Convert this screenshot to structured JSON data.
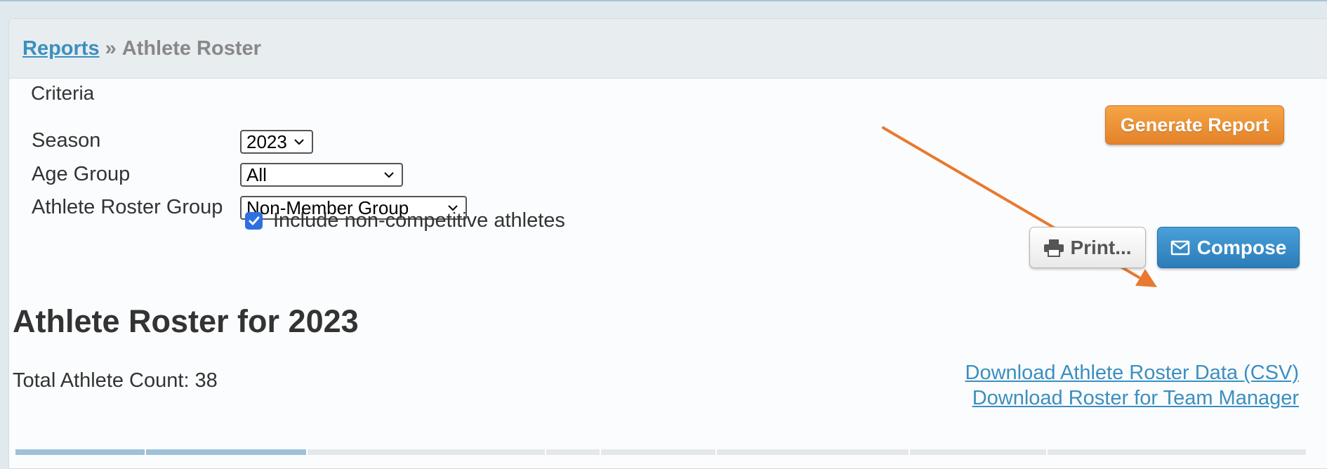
{
  "breadcrumb": {
    "root": "Reports",
    "separator": "»",
    "current": "Athlete Roster"
  },
  "criteria": {
    "heading": "Criteria",
    "season": {
      "label": "Season",
      "value": "2023"
    },
    "age_group": {
      "label": "Age Group",
      "value": "All"
    },
    "roster_group": {
      "label": "Athlete Roster Group",
      "value": "Non-Member Group"
    },
    "include_noncompetitive": {
      "label": "Include non-competitive athletes",
      "checked": true
    }
  },
  "buttons": {
    "generate": "Generate Report",
    "print": "Print...",
    "compose": "Compose"
  },
  "report": {
    "title": "Athlete Roster for 2023",
    "total_count": "Total Athlete Count: 38"
  },
  "downloads": {
    "csv": "Download Athlete Roster Data (CSV)",
    "team_manager": "Download Roster for Team Manager"
  },
  "colors": {
    "accent_orange": "#e4822a",
    "accent_blue": "#2b7cb8",
    "link_blue": "#3b8fc0",
    "annotation_arrow": "#e8792f"
  },
  "icons": {
    "print": "printer-icon",
    "compose": "envelope-icon",
    "select": "chevron-down-icon",
    "checkbox": "checkmark-icon"
  }
}
